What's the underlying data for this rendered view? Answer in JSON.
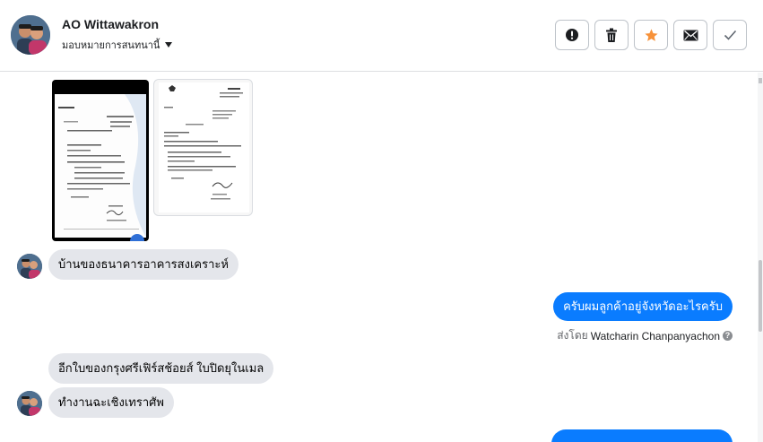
{
  "header": {
    "contact_name": "AO Wittawakron",
    "assign_label": "มอบหมายการสนทนานี้",
    "actions": [
      {
        "icon": "alert-icon",
        "tooltip": "spam"
      },
      {
        "icon": "trash-icon",
        "tooltip": "delete"
      },
      {
        "icon": "star-icon",
        "tooltip": "follow up"
      },
      {
        "icon": "envelope-icon",
        "tooltip": "mark unread"
      },
      {
        "icon": "check-icon",
        "tooltip": "done"
      }
    ]
  },
  "colors": {
    "outgoing_bubble": "#0a7cff",
    "incoming_bubble": "#e4e6eb",
    "star": "#f7923a"
  },
  "messages": [
    {
      "direction": "in",
      "type": "attachments",
      "count": 2
    },
    {
      "direction": "in",
      "text": "บ้านของธนาคารอาคารสงเคราะห์"
    },
    {
      "direction": "out",
      "text": "ครับผมลูกค้าอยู่จังหวัดอะไรครับ"
    },
    {
      "direction": "out",
      "type": "sent-by",
      "prefix": "ส่งโดย",
      "sender": "Watcharin Chanpanyachon"
    },
    {
      "direction": "in",
      "text": "อีกใบของกรุงศรีเฟิร์สช้อยส์ ใบปิดยุในเมล"
    },
    {
      "direction": "in",
      "text": "ทำงานฉะเชิงเทราศัพ"
    }
  ]
}
